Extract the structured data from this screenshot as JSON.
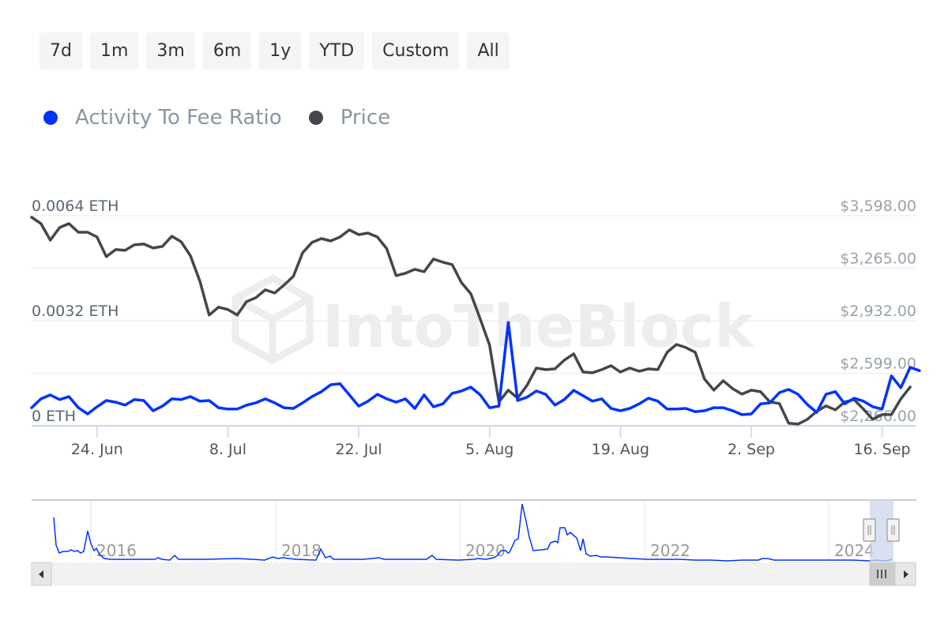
{
  "range_selector": {
    "buttons": [
      "7d",
      "1m",
      "3m",
      "6m",
      "1y",
      "YTD",
      "Custom",
      "All"
    ]
  },
  "legend": {
    "items": [
      {
        "label": "Activity To Fee Ratio",
        "color": "#0033ff"
      },
      {
        "label": "Price",
        "color": "#43474b"
      }
    ]
  },
  "watermark": "IntoTheBlock",
  "colors": {
    "ratio_line": "#0033ff",
    "price_line": "#43474b",
    "grid": "#f0f0f0",
    "axis_line": "#ccd6eb",
    "left_label": "#5a6673",
    "right_label": "#98a3ad",
    "x_label": "#555555",
    "navigator_mask": "#ccd6eb"
  },
  "chart_data": {
    "type": "line",
    "title": "",
    "x_start": "2024-06-17",
    "x_step_days": 1,
    "x_tick_labels": [
      "24. Jun",
      "8. Jul",
      "22. Jul",
      "5. Aug",
      "19. Aug",
      "2. Sep",
      "16. Sep"
    ],
    "x_tick_days": [
      7,
      21,
      35,
      49,
      63,
      77,
      91
    ],
    "x_range_days": [
      0,
      94.5
    ],
    "grid": true,
    "legend_position": "top-left",
    "y_left": {
      "label": "",
      "tick_labels": [
        "0.0064 ETH",
        "0.0032 ETH",
        "0 ETH"
      ],
      "tick_values": [
        0.0064,
        0.0032,
        0
      ],
      "range": [
        0,
        0.0064
      ]
    },
    "y_right": {
      "label": "",
      "tick_labels": [
        "$3,598.00",
        "$3,265.00",
        "$2,932.00",
        "$2,599.00",
        "$2,266.00"
      ],
      "tick_values": [
        3598,
        3265,
        2932,
        2599,
        2266
      ],
      "range": [
        2266,
        3598
      ]
    },
    "series": [
      {
        "name": "Activity To Fee Ratio",
        "axis": "left",
        "values": [
          0.00055,
          0.00082,
          0.00094,
          0.0008,
          0.00089,
          0.00055,
          0.00036,
          0.00058,
          0.00077,
          0.00072,
          0.00063,
          0.0008,
          0.00077,
          0.00046,
          0.0006,
          0.00082,
          0.0008,
          0.00089,
          0.00075,
          0.00077,
          0.00055,
          0.00051,
          0.00051,
          0.00063,
          0.0007,
          0.00082,
          0.0007,
          0.00055,
          0.00053,
          0.0007,
          0.00089,
          0.00104,
          0.00125,
          0.00128,
          0.00094,
          0.0006,
          0.00075,
          0.00096,
          0.00082,
          0.00072,
          0.00082,
          0.00053,
          0.00094,
          0.00058,
          0.00067,
          0.00099,
          0.00106,
          0.00118,
          0.00094,
          0.00055,
          0.0006,
          0.00315,
          0.00077,
          0.00087,
          0.00106,
          0.00096,
          0.00063,
          0.0008,
          0.00108,
          0.00092,
          0.00075,
          0.00082,
          0.00053,
          0.00046,
          0.00053,
          0.00067,
          0.00084,
          0.00075,
          0.00051,
          0.00051,
          0.00053,
          0.00043,
          0.00046,
          0.00055,
          0.00055,
          0.00046,
          0.00034,
          0.00036,
          0.00067,
          0.0007,
          0.00101,
          0.00111,
          0.00096,
          0.00065,
          0.00041,
          0.00096,
          0.00104,
          0.00067,
          0.00084,
          0.00075,
          0.00058,
          0.00051,
          0.00152,
          0.00116,
          0.00178,
          0.00168
        ]
      },
      {
        "name": "Price",
        "axis": "right",
        "values": [
          3588,
          3548,
          3443,
          3523,
          3548,
          3493,
          3493,
          3463,
          3338,
          3383,
          3378,
          3413,
          3418,
          3393,
          3403,
          3468,
          3433,
          3343,
          3183,
          2968,
          3018,
          3003,
          2968,
          3053,
          3078,
          3128,
          3108,
          3158,
          3213,
          3363,
          3428,
          3453,
          3438,
          3463,
          3508,
          3478,
          3488,
          3463,
          3388,
          3218,
          3233,
          3258,
          3243,
          3323,
          3303,
          3288,
          3173,
          3103,
          2943,
          2778,
          2417,
          2492,
          2442,
          2522,
          2632,
          2622,
          2627,
          2682,
          2722,
          2607,
          2602,
          2622,
          2647,
          2607,
          2632,
          2612,
          2627,
          2622,
          2732,
          2782,
          2762,
          2732,
          2562,
          2492,
          2552,
          2502,
          2467,
          2492,
          2482,
          2417,
          2407,
          2282,
          2277,
          2307,
          2357,
          2392,
          2367,
          2417,
          2432,
          2372,
          2307,
          2337,
          2337,
          2437,
          2512
        ]
      }
    ],
    "navigator": {
      "x_tick_labels": [
        "2016",
        "2018",
        "2020",
        "2022",
        "2024"
      ],
      "series_name": "Activity To Fee Ratio",
      "selected_range_fraction": [
        0.966,
        0.993
      ]
    }
  }
}
